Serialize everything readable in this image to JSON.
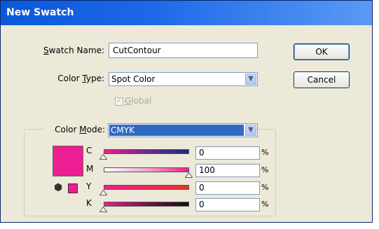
{
  "dialog": {
    "title": "New Swatch"
  },
  "swatch_name": {
    "label_prefix": "S",
    "label_rest": "watch Name:",
    "value": "CutContour"
  },
  "color_type": {
    "label_a": "Color ",
    "label_u": "T",
    "label_b": "ype:",
    "value": "Spot Color"
  },
  "global": {
    "label_u": "G",
    "label_rest": "lobal",
    "checked": true
  },
  "color_mode": {
    "label_a": "Color ",
    "label_u": "M",
    "label_b": "ode:",
    "value": "CMYK"
  },
  "buttons": {
    "ok": "OK",
    "cancel": "Cancel"
  },
  "swatch_color": "#ed1e91",
  "channels": [
    {
      "letter": "C",
      "value": "0",
      "unit": "%",
      "level": 0
    },
    {
      "letter": "M",
      "value": "100",
      "unit": "%",
      "level": 100
    },
    {
      "letter": "Y",
      "value": "0",
      "unit": "%",
      "level": 0
    },
    {
      "letter": "K",
      "value": "0",
      "unit": "%",
      "level": 0
    }
  ],
  "icons": {
    "cube": "out-of-gamut-cube-icon",
    "arrow": "chevron-down-icon"
  }
}
